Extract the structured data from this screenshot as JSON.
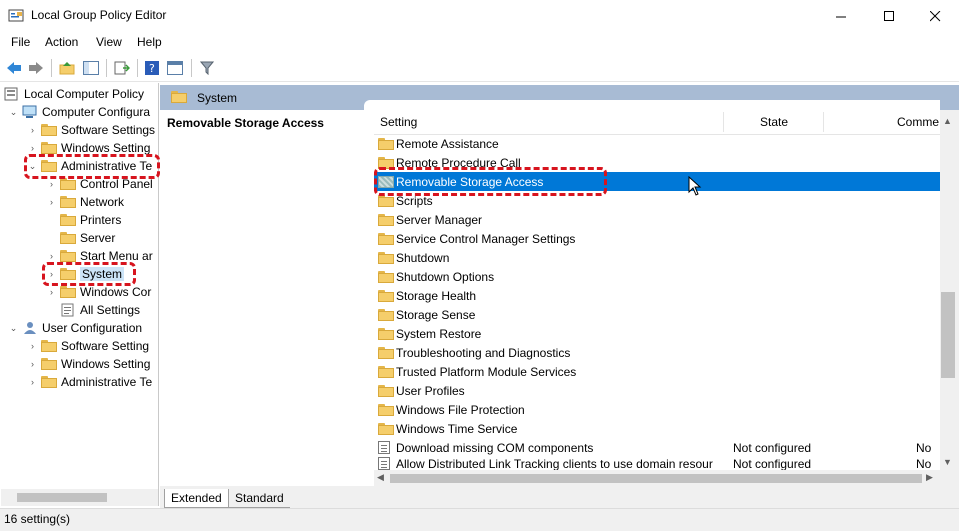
{
  "window": {
    "title": "Local Group Policy Editor",
    "minimize": "—",
    "maximize": "☐",
    "close": "✕"
  },
  "menu": [
    "File",
    "Action",
    "View",
    "Help"
  ],
  "tree": {
    "root": "Local Computer Policy",
    "computer_config": "Computer Configura",
    "cc_software": "Software Settings",
    "cc_windows": "Windows Setting",
    "cc_admin": "Administrative Te",
    "control_panel": "Control Panel",
    "network": "Network",
    "printers": "Printers",
    "server": "Server",
    "start_menu": "Start Menu ar",
    "system": "System",
    "windows_comp": "Windows Cor",
    "all_settings": "All Settings",
    "user_config": "User Configuration",
    "uc_software": "Software Setting",
    "uc_windows": "Windows Setting",
    "uc_admin": "Administrative Te"
  },
  "header": {
    "title": "System"
  },
  "description": {
    "title": "Removable Storage Access"
  },
  "columns": {
    "setting": "Setting",
    "state": "State",
    "comment": "Comme"
  },
  "rows": [
    {
      "name": "Remote Assistance",
      "state": "",
      "comment": ""
    },
    {
      "name": "Remote Procedure Call",
      "state": "",
      "comment": ""
    },
    {
      "name": "Removable Storage Access",
      "state": "",
      "comment": ""
    },
    {
      "name": "Scripts",
      "state": "",
      "comment": ""
    },
    {
      "name": "Server Manager",
      "state": "",
      "comment": ""
    },
    {
      "name": "Service Control Manager Settings",
      "state": "",
      "comment": ""
    },
    {
      "name": "Shutdown",
      "state": "",
      "comment": ""
    },
    {
      "name": "Shutdown Options",
      "state": "",
      "comment": ""
    },
    {
      "name": "Storage Health",
      "state": "",
      "comment": ""
    },
    {
      "name": "Storage Sense",
      "state": "",
      "comment": ""
    },
    {
      "name": "System Restore",
      "state": "",
      "comment": ""
    },
    {
      "name": "Troubleshooting and Diagnostics",
      "state": "",
      "comment": ""
    },
    {
      "name": "Trusted Platform Module Services",
      "state": "",
      "comment": ""
    },
    {
      "name": "User Profiles",
      "state": "",
      "comment": ""
    },
    {
      "name": "Windows File Protection",
      "state": "",
      "comment": ""
    },
    {
      "name": "Windows Time Service",
      "state": "",
      "comment": ""
    },
    {
      "name": "Download missing COM components",
      "state": "Not configured",
      "comment": "No"
    },
    {
      "name": "Allow Distributed Link Tracking clients to use domain resour",
      "state": "Not configured",
      "comment": "No"
    }
  ],
  "tabs": {
    "extended": "Extended",
    "standard": "Standard"
  },
  "status": {
    "text": "16 setting(s)"
  },
  "colors": {
    "selection": "#0078d7",
    "header_band": "#a8bbd4",
    "highlight_dash": "#d7141e"
  }
}
